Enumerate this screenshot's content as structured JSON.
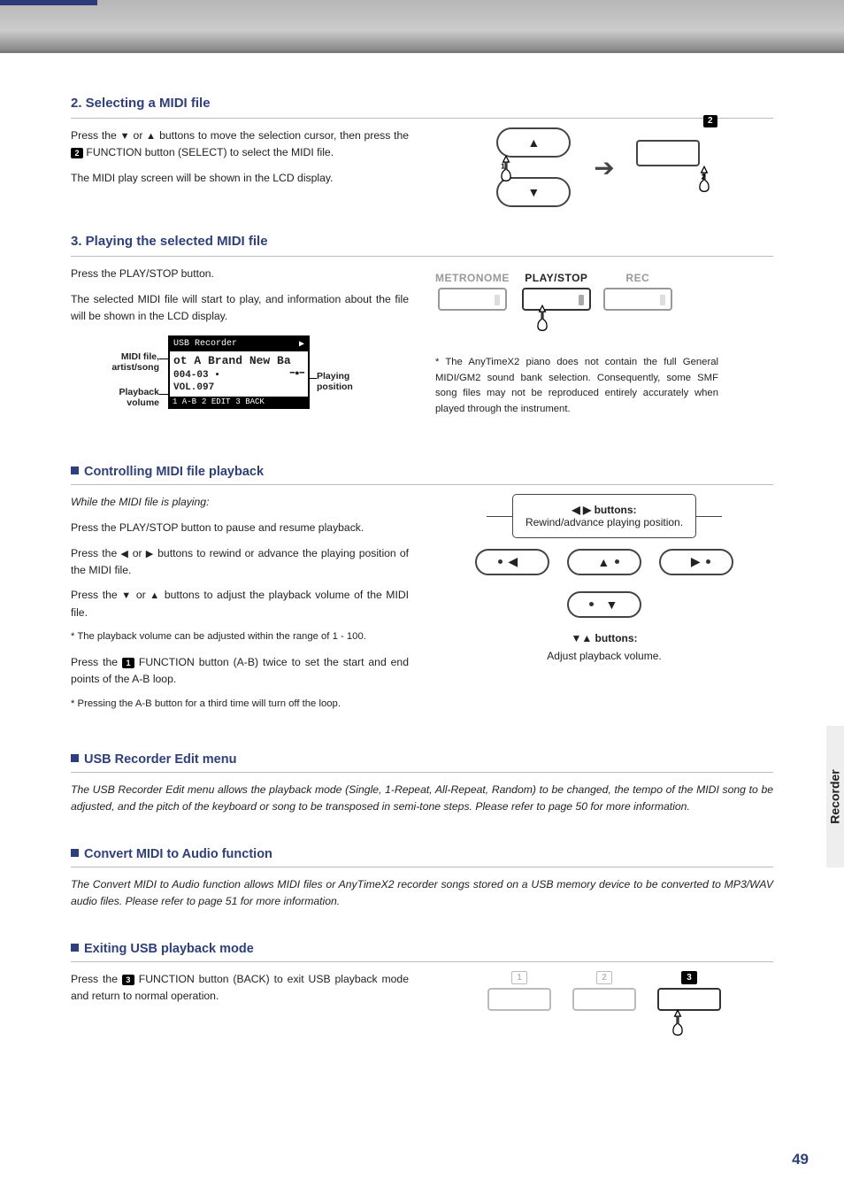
{
  "side_tab": "Recorder",
  "page_number": "49",
  "sec2": {
    "title": "2. Selecting a MIDI file",
    "p1a": "Press the ",
    "p1b": " or ",
    "p1c": " buttons to move the selection cursor, then press the ",
    "p1_fn": "2",
    "p1d": " FUNCTION button (SELECT) to select the MIDI file.",
    "p2": "The MIDI play screen will be shown in the LCD display.",
    "diag_fn_num": "2"
  },
  "sec3": {
    "title": "3. Playing the selected MIDI file",
    "p1": "Press the PLAY/STOP button.",
    "p2": "The selected MIDI file will start to play, and information about the file will be shown in the LCD display.",
    "trio_labels": {
      "metronome": "METRONOME",
      "playstop": "PLAY/STOP",
      "rec": "REC"
    },
    "footnote": "* The AnyTimeX2 piano does not contain the full General MIDI/GM2 sound bank selection.  Consequently, some SMF song files may not be reproduced entirely accurately when played through the instrument.",
    "lcd": {
      "title": "USB Recorder",
      "line1": "ot A Brand New Ba",
      "line2": "004-03 ▪",
      "line3": "VOL.097",
      "foot1": "1  A-B",
      "foot2": "2 EDIT",
      "foot3": "3 BACK"
    },
    "lcd_labels": {
      "midi": "MIDI file,\nartist/song",
      "vol": "Playback\nvolume",
      "pos": "Playing\nposition"
    }
  },
  "ctrl": {
    "title": "Controlling MIDI file playback",
    "intro": "While the MIDI file is playing:",
    "p1": "Press the PLAY/STOP button to pause and resume playback.",
    "p2a": "Press the ",
    "p2b": " or ",
    "p2c": " buttons to rewind or advance the playing position of the MIDI file.",
    "p3a": "Press the ",
    "p3b": " or ",
    "p3c": " buttons to adjust the playback volume of the MIDI file.",
    "note1": "* The playback volume can be adjusted within the range of 1 - 100.",
    "p4a": "Press the ",
    "p4_fn": "1",
    "p4b": " FUNCTION button (A-B) twice to set the start and end points of the A-B loop.",
    "note2": "* Pressing the A-B button for a third time will turn off the loop.",
    "dpad": {
      "lr_title": "◀ ▶ buttons:",
      "lr_sub": "Rewind/advance playing position.",
      "ud_title": "▼▲ buttons:",
      "ud_sub": "Adjust playback volume."
    }
  },
  "edit": {
    "title": "USB Recorder Edit menu",
    "p": "The USB Recorder Edit menu allows the playback mode (Single, 1-Repeat, All-Repeat, Random) to be changed, the tempo of the MIDI song to be adjusted, and the pitch of the keyboard or song to be transposed in semi-tone steps.  Please refer to page 50 for more information."
  },
  "convert": {
    "title": "Convert MIDI to Audio function",
    "p": "The Convert MIDI to Audio function allows MIDI files or AnyTimeX2 recorder songs stored on a USB memory device to be converted to MP3/WAV audio files.  Please refer to page 51 for more information."
  },
  "exit": {
    "title": "Exiting USB playback mode",
    "p_a": "Press the ",
    "p_fn": "3",
    "p_b": " FUNCTION button (BACK) to exit USB playback mode and return to normal operation.",
    "fn_nums": [
      "1",
      "2",
      "3"
    ]
  }
}
